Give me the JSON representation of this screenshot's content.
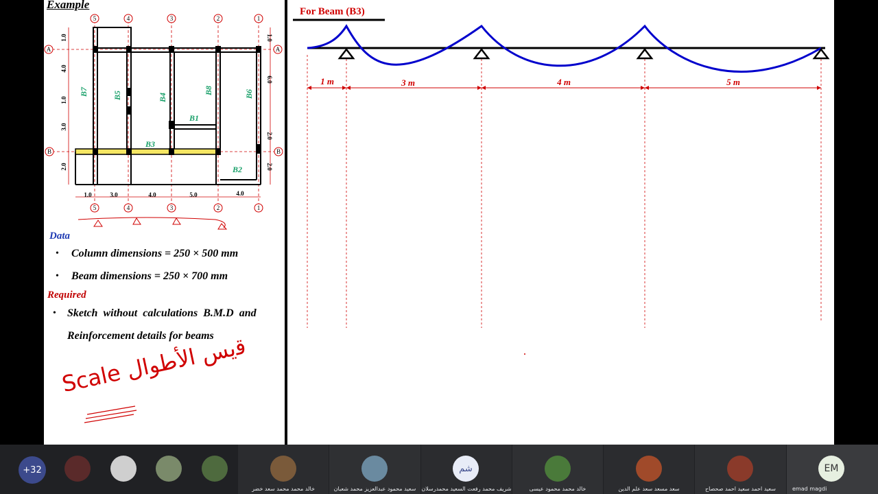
{
  "slide": {
    "example_title": "Example",
    "data_heading": "Data",
    "data_items": [
      "Column dimensions = 250 × 500 mm",
      "Beam dimensions = 250 × 700 mm"
    ],
    "required_heading": "Required",
    "required_line1": "Sketch  without  calculations  B.M.D  and",
    "required_line2": "Reinforcement details for beams",
    "handwritten_note": "Scale ﻗيس الأطوال"
  },
  "plan": {
    "axis_top_labels": [
      "5",
      "4",
      "3",
      "2",
      "1"
    ],
    "axis_bottom_labels": [
      "5",
      "4",
      "3",
      "2",
      "1"
    ],
    "row_labels": [
      "A",
      "B"
    ],
    "left_dims": [
      "1.0",
      "4.0",
      "1.0",
      "3.0",
      "2.0"
    ],
    "right_dims": [
      "1.0",
      "6.0",
      "2.0",
      "2.0"
    ],
    "bottom_dims": [
      "1.0",
      "3.0",
      "4.0",
      "5.0",
      "4.0"
    ],
    "beam_labels": [
      "B7",
      "B5",
      "B4",
      "B8",
      "B6",
      "B1",
      "B3",
      "B2"
    ]
  },
  "beam_diagram": {
    "title": "For Beam (B3)",
    "spans": [
      "1 m",
      "3 m",
      "4 m",
      "5 m"
    ],
    "colors": {
      "moment": "#0000cc",
      "dimension": "#d00000",
      "beam": "#000000"
    }
  },
  "participants": {
    "more_count": "+32",
    "tiles": [
      {
        "name": "خالد محمد محمد سعد خضر"
      },
      {
        "name": "سعيد محمود عبدالعزيز محمد شعبان"
      },
      {
        "name": "شريف محمد رفعت السعيد محمدرسلان",
        "initials": "شم"
      },
      {
        "name": "خالد محمد محمود عيسى"
      },
      {
        "name": "سعد مسعد سعد علم الدين"
      },
      {
        "name": "سعيد احمد سعيد احمد صحصاح"
      },
      {
        "name": "emad magdi",
        "initials": "EM"
      }
    ]
  }
}
